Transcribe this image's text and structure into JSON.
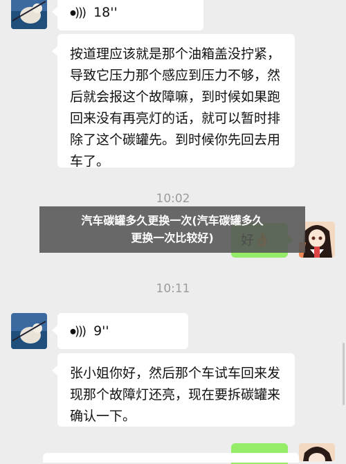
{
  "messages": {
    "voice1": {
      "duration": "18''",
      "wave_glyph": "◝◝◝"
    },
    "text1": "按道理应该就是那个油箱盖没拧紧，导致它压力那个感应到压力不够，然后就会报这个故障嘛，到时候如果跑回来没有再亮灯的话，就可以暂时排除了这个碳罐先。到时候你先回去用车了。",
    "time1": "10:02",
    "reply1": "好👌",
    "time2": "10:11",
    "voice2": {
      "duration": "9''",
      "wave_glyph": "◝◝◝"
    },
    "text2": "张小姐你好，然后那个车试车回来发现那个故障灯还亮，现在要拆碳罐来确认一下。"
  },
  "banner": {
    "line1": "汽车碳罐多久更换一次(汽车碳罐多久",
    "line2": "更换一次比较好)"
  },
  "colors": {
    "background": "#ededed",
    "incoming_bubble": "#ffffff",
    "outgoing_bubble": "#95ec69",
    "timestamp": "#9b9b9b"
  }
}
